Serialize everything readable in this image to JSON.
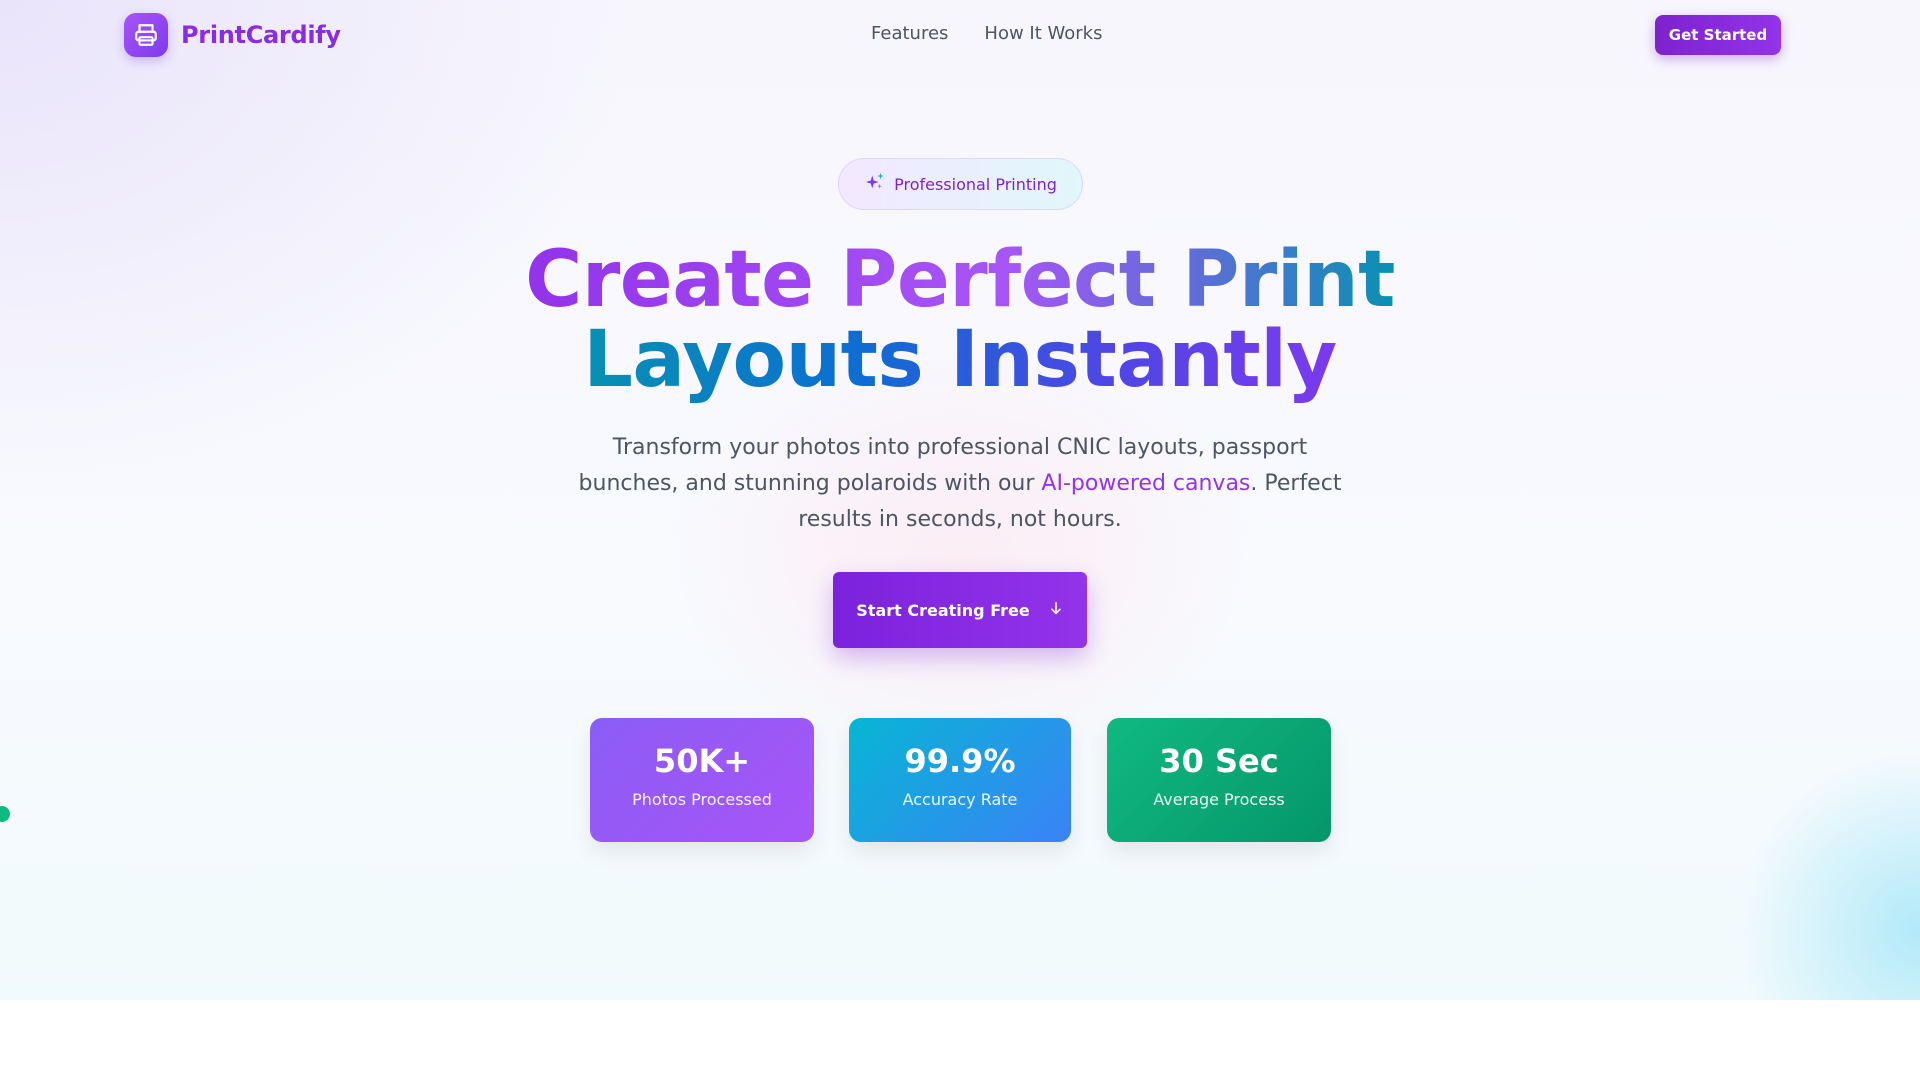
{
  "brand": {
    "name": "PrintCardify",
    "icon": "printer-icon",
    "accent": "#9333ea"
  },
  "nav": {
    "links": [
      "Features",
      "How It Works"
    ],
    "cta_label": "Get Started"
  },
  "hero": {
    "badge": {
      "icon": "sparkles-icon",
      "label": "Professional Printing"
    },
    "headline": {
      "line1": "Create Perfect Print",
      "line2": "Layouts Instantly"
    },
    "subtext": {
      "part1": "Transform your photos into professional CNIC layouts, passport bunches, and stunning polaroids with our ",
      "highlight": "AI-powered canvas",
      "part2": ". Perfect results in seconds, not hours."
    },
    "cta": {
      "label": "Start Creating Free",
      "icon": "arrow-down-icon"
    }
  },
  "stats": [
    {
      "value": "50K+",
      "label": "Photos Processed",
      "color": "#8b5cf6"
    },
    {
      "value": "99.9%",
      "label": "Accuracy Rate",
      "color": "#06b6d4"
    },
    {
      "value": "30 Sec",
      "label": "Average Process",
      "color": "#10b981"
    }
  ]
}
